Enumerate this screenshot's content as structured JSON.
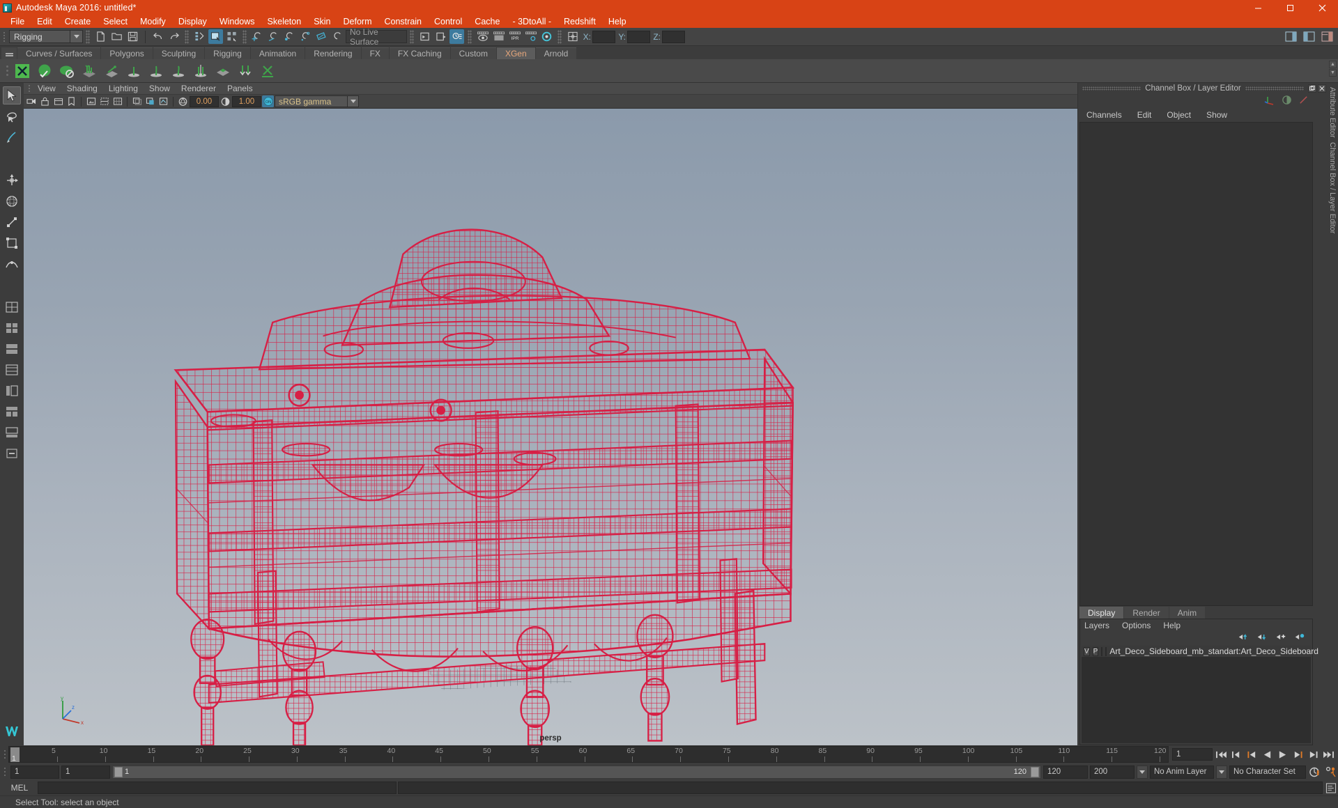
{
  "titlebar": {
    "title": "Autodesk Maya 2016: untitled*",
    "icon": "maya-app-icon",
    "minimize": "–",
    "maximize": "❐",
    "close": "✕"
  },
  "menubar": {
    "items": [
      "File",
      "Edit",
      "Create",
      "Select",
      "Modify",
      "Display",
      "Windows",
      "Skeleton",
      "Skin",
      "Deform",
      "Constrain",
      "Control",
      "Cache",
      "- 3DtoAll -",
      "Redshift",
      "Help"
    ]
  },
  "statusline": {
    "menu_set": "Rigging",
    "live_surface": "No Live Surface",
    "coord_x_label": "X:",
    "coord_y_label": "Y:",
    "coord_z_label": "Z:",
    "coord_x_value": "",
    "coord_y_value": "",
    "coord_z_value": "",
    "icons": [
      "new-scene-icon",
      "open-scene-icon",
      "save-scene-icon",
      "undo-icon",
      "redo-icon",
      "select-by-hierarchy-icon",
      "select-by-object-icon",
      "select-by-component-icon",
      "snap-to-grid-icon",
      "snap-to-curve-icon",
      "snap-to-point-icon",
      "snap-to-projected-center-icon",
      "snap-to-view-plane-icon",
      "make-live-icon",
      "render-current-frame-icon",
      "ipr-render-icon",
      "render-settings-icon",
      "hypershade-icon",
      "show-manipulator-icon",
      "input-connection-icon",
      "output-connection-icon",
      "construction-history-icon",
      "render-view-icon"
    ]
  },
  "shelf": {
    "tabs": [
      "Curves / Surfaces",
      "Polygons",
      "Sculpting",
      "Rigging",
      "Animation",
      "Rendering",
      "FX",
      "FX Caching",
      "Custom",
      "XGen",
      "Arnold"
    ],
    "active_tab": "XGen",
    "buttons": [
      "xgen-editor-icon",
      "xgen-sphere-icon",
      "xgen-dome-icon",
      "xgen-add-description-icon",
      "xgen-guide-icon",
      "xgen-groom-brush-icon",
      "xgen-density-icon",
      "xgen-length-icon",
      "xgen-clump-icon",
      "xgen-noise-icon",
      "xgen-cut-icon",
      "xgen-convert-icon"
    ]
  },
  "toolbox": {
    "tools": [
      "select-tool",
      "lasso-select-tool",
      "paint-select-tool",
      "move-tool",
      "rotate-tool",
      "scale-tool",
      "universal-manip-tool",
      "soft-mod-tool",
      "show-manipulator-tool",
      "last-tool",
      "layout-single-pane",
      "layout-two-pane-vertical",
      "layout-two-pane-horizontal",
      "layout-four-pane",
      "layout-persp-outliner",
      "layout-hypershade",
      "layout-persp-graph",
      "layout-more"
    ],
    "logo": "maya-logo"
  },
  "viewport": {
    "panel_menus": [
      "View",
      "Shading",
      "Lighting",
      "Show",
      "Renderer",
      "Panels"
    ],
    "camera_label": "persp",
    "toolbar": {
      "exposure_value": "0.00",
      "gamma_value": "1.00",
      "color_management": "sRGB gamma",
      "color_mgmt_toggle": "ON",
      "icons": [
        "select-camera-icon",
        "lock-camera-icon",
        "camera-attributes-icon",
        "bookmark-icon",
        "image-plane-icon",
        "twoD-pan-zoom-icon",
        "grid-icon",
        "film-gate-icon",
        "resolution-gate-icon",
        "gate-mask-icon",
        "wireframe-icon",
        "smooth-shade-icon",
        "textured-icon",
        "lights-icon",
        "shadows-icon",
        "ao-icon",
        "motion-blur-icon",
        "aa-icon",
        "xray-icon",
        "xray-joints-icon",
        "xray-active-components-icon",
        "exposure-icon",
        "gamma-icon"
      ]
    },
    "gizmo_axes": [
      "x",
      "y",
      "z"
    ],
    "model": {
      "name": "Art Deco Sideboard wireframe",
      "wire_color": "#d71f45"
    }
  },
  "rightdock": {
    "panel_title": "Channel Box / Layer Editor",
    "undock_icon": "undock-icon",
    "close_icon": "close-icon",
    "channelbox_menus": [
      "Channels",
      "Edit",
      "Object",
      "Show"
    ],
    "channelbox_icons": [
      "channelbox-toggle-icon",
      "attribute-editor-toggle-icon",
      "tool-settings-toggle-icon"
    ],
    "layer_tabs": [
      "Display",
      "Render",
      "Anim"
    ],
    "layer_tab_active": "Display",
    "layer_menus": [
      "Layers",
      "Options",
      "Help"
    ],
    "layer_icons": [
      "move-layer-up-icon",
      "move-layer-down-icon",
      "new-layer-icon",
      "new-layer-from-selected-icon"
    ],
    "layers": [
      {
        "visibility": "V",
        "playback": "P",
        "type": "",
        "color": "#c3093b",
        "name": "Art_Deco_Sideboard_mb_standart:Art_Deco_Sideboard"
      }
    ],
    "side_tabs": [
      "Attribute Editor",
      "Channel Box / Layer Editor"
    ]
  },
  "timeline": {
    "ticks": [
      {
        "value": "5",
        "pos": 5
      },
      {
        "value": "10",
        "pos": 10
      },
      {
        "value": "15",
        "pos": 15
      },
      {
        "value": "20",
        "pos": 20
      },
      {
        "value": "25",
        "pos": 25
      },
      {
        "value": "30",
        "pos": 30
      },
      {
        "value": "35",
        "pos": 35
      },
      {
        "value": "40",
        "pos": 40
      },
      {
        "value": "45",
        "pos": 45
      },
      {
        "value": "50",
        "pos": 50
      },
      {
        "value": "55",
        "pos": 55
      },
      {
        "value": "60",
        "pos": 60
      },
      {
        "value": "65",
        "pos": 65
      },
      {
        "value": "70",
        "pos": 70
      },
      {
        "value": "75",
        "pos": 75
      },
      {
        "value": "80",
        "pos": 80
      },
      {
        "value": "85",
        "pos": 85
      },
      {
        "value": "90",
        "pos": 90
      },
      {
        "value": "95",
        "pos": 95
      },
      {
        "value": "100",
        "pos": 100
      },
      {
        "value": "105",
        "pos": 105
      },
      {
        "value": "110",
        "pos": 110
      },
      {
        "value": "115",
        "pos": 115
      },
      {
        "value": "120",
        "pos": 120
      }
    ],
    "range_start": 1,
    "range_end": 120,
    "current_frame": "1",
    "current_frame_field": "1",
    "playback_icons": [
      "go-to-start-icon",
      "step-back-keyframe-icon",
      "step-back-frame-icon",
      "play-backwards-icon",
      "play-forwards-icon",
      "step-forward-frame-icon",
      "step-forward-keyframe-icon",
      "go-to-end-icon"
    ]
  },
  "rangeslider": {
    "anim_start": "1",
    "range_start": "1",
    "slider_start_label": "1",
    "slider_end_label": "120",
    "range_end": "120",
    "anim_end": "200",
    "anim_layer": "No Anim Layer",
    "character_set": "No Character Set",
    "auto_key_icon": "auto-keyframe-icon",
    "anim_prefs_icon": "animation-preferences-icon"
  },
  "commandline": {
    "label": "MEL",
    "input_value": "",
    "output_value": "",
    "script_editor_icon": "script-editor-icon"
  },
  "helpline": {
    "text": "Select Tool: select an object"
  }
}
